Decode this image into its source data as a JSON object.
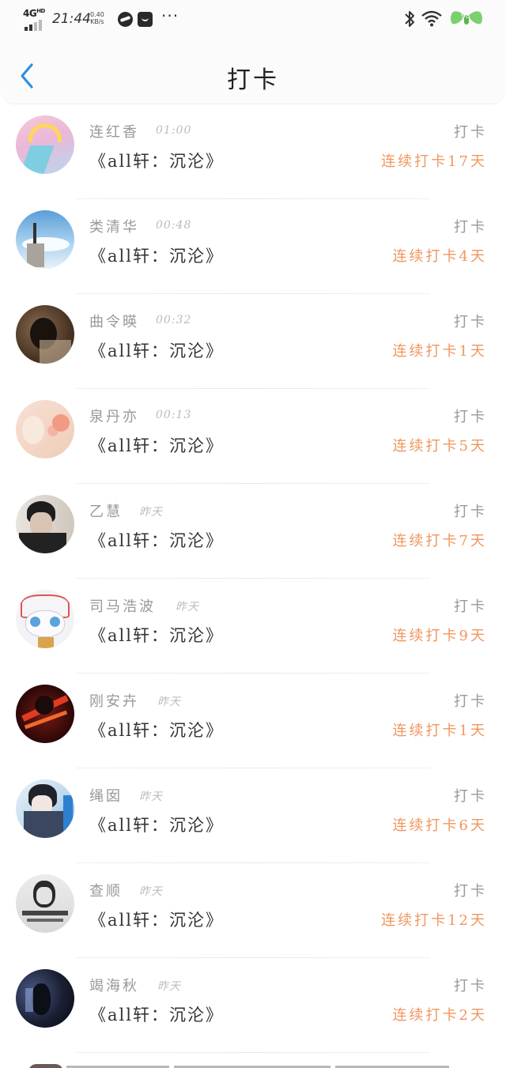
{
  "status_bar": {
    "network": "4G",
    "network_sup": "HD",
    "time": "21:44",
    "speed_value": "0.40",
    "speed_unit": "KB/s",
    "more": "···",
    "battery": "98"
  },
  "header": {
    "title": "打卡"
  },
  "list": [
    {
      "name": "连红香",
      "time": "01:00",
      "book": "《all轩：沉沦》",
      "action": "打卡",
      "streak": "连续打卡17天"
    },
    {
      "name": "类清华",
      "time": "00:48",
      "book": "《all轩：沉沦》",
      "action": "打卡",
      "streak": "连续打卡4天"
    },
    {
      "name": "曲令暎",
      "time": "00:32",
      "book": "《all轩：沉沦》",
      "action": "打卡",
      "streak": "连续打卡1天"
    },
    {
      "name": "泉丹亦",
      "time": "00:13",
      "book": "《all轩：沉沦》",
      "action": "打卡",
      "streak": "连续打卡5天"
    },
    {
      "name": "乙慧",
      "time": "昨天",
      "book": "《all轩：沉沦》",
      "action": "打卡",
      "streak": "连续打卡7天"
    },
    {
      "name": "司马浩波",
      "time": "昨天",
      "book": "《all轩：沉沦》",
      "action": "打卡",
      "streak": "连续打卡9天"
    },
    {
      "name": "刚安卉",
      "time": "昨天",
      "book": "《all轩：沉沦》",
      "action": "打卡",
      "streak": "连续打卡1天"
    },
    {
      "name": "绳囡",
      "time": "昨天",
      "book": "《all轩：沉沦》",
      "action": "打卡",
      "streak": "连续打卡6天"
    },
    {
      "name": "查顺",
      "time": "昨天",
      "book": "《all轩：沉沦》",
      "action": "打卡",
      "streak": "连续打卡12天"
    },
    {
      "name": "竭海秋",
      "time": "昨天",
      "book": "《all轩：沉沦》",
      "action": "打卡",
      "streak": "连续打卡2天"
    }
  ],
  "colors": {
    "accent_blue": "#2f8fe0",
    "streak_orange": "#f0965e",
    "name_gray": "#999999"
  }
}
